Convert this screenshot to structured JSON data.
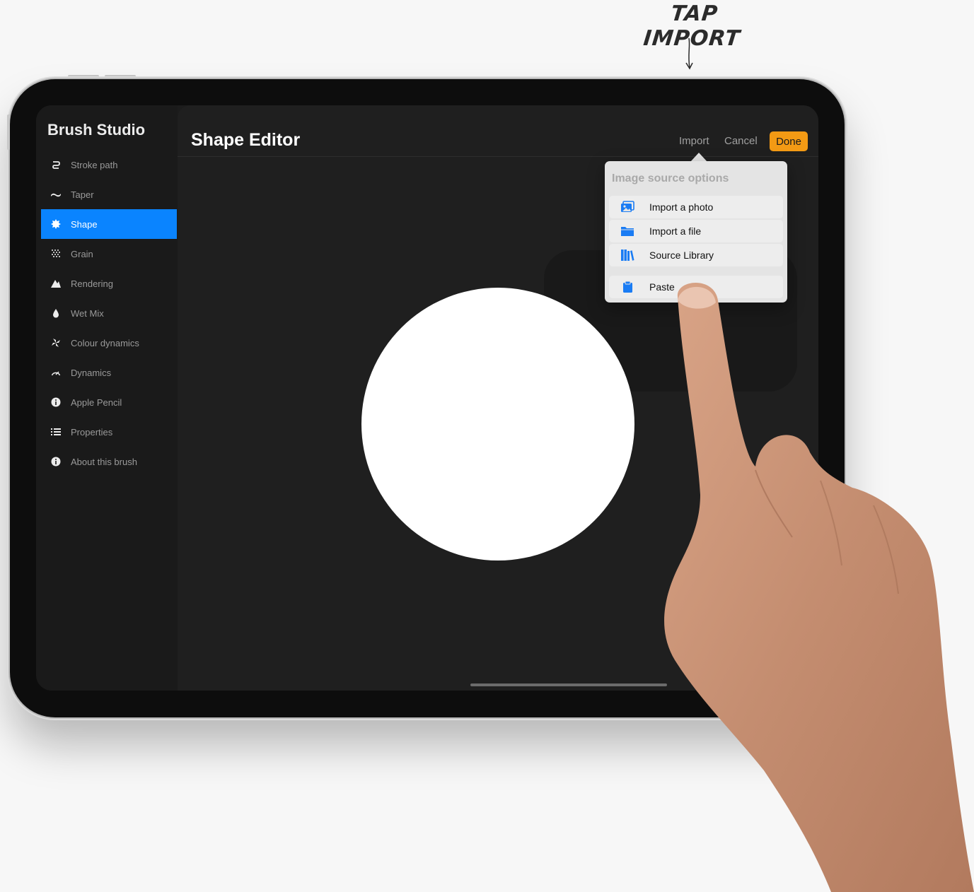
{
  "annotation": {
    "text": "TAP IMPORT"
  },
  "sidebar": {
    "title": "Brush Studio",
    "items": [
      {
        "label": "Stroke path",
        "icon": "stroke-path-icon"
      },
      {
        "label": "Taper",
        "icon": "taper-icon"
      },
      {
        "label": "Shape",
        "icon": "shape-icon",
        "active": true
      },
      {
        "label": "Grain",
        "icon": "grain-icon"
      },
      {
        "label": "Rendering",
        "icon": "rendering-icon"
      },
      {
        "label": "Wet Mix",
        "icon": "wet-mix-icon"
      },
      {
        "label": "Colour dynamics",
        "icon": "colour-dynamics-icon"
      },
      {
        "label": "Dynamics",
        "icon": "dynamics-icon"
      },
      {
        "label": "Apple Pencil",
        "icon": "apple-pencil-icon"
      },
      {
        "label": "Properties",
        "icon": "properties-icon"
      },
      {
        "label": "About this brush",
        "icon": "info-icon"
      }
    ]
  },
  "main": {
    "title": "Shape Editor"
  },
  "toolbar": {
    "import_label": "Import",
    "cancel_label": "Cancel",
    "done_label": "Done"
  },
  "popover": {
    "title": "Image source options",
    "items": [
      {
        "label": "Import a photo",
        "icon": "photo-icon"
      },
      {
        "label": "Import a file",
        "icon": "folder-icon"
      },
      {
        "label": "Source Library",
        "icon": "library-icon"
      },
      {
        "label": "Paste",
        "icon": "clipboard-icon"
      }
    ]
  },
  "colors": {
    "accent": "#0a84ff",
    "done_button": "#f39a14",
    "icon_blue": "#1a7cf4",
    "screen_bg": "#1f1f1f",
    "sidebar_bg": "#1a1a1a"
  }
}
